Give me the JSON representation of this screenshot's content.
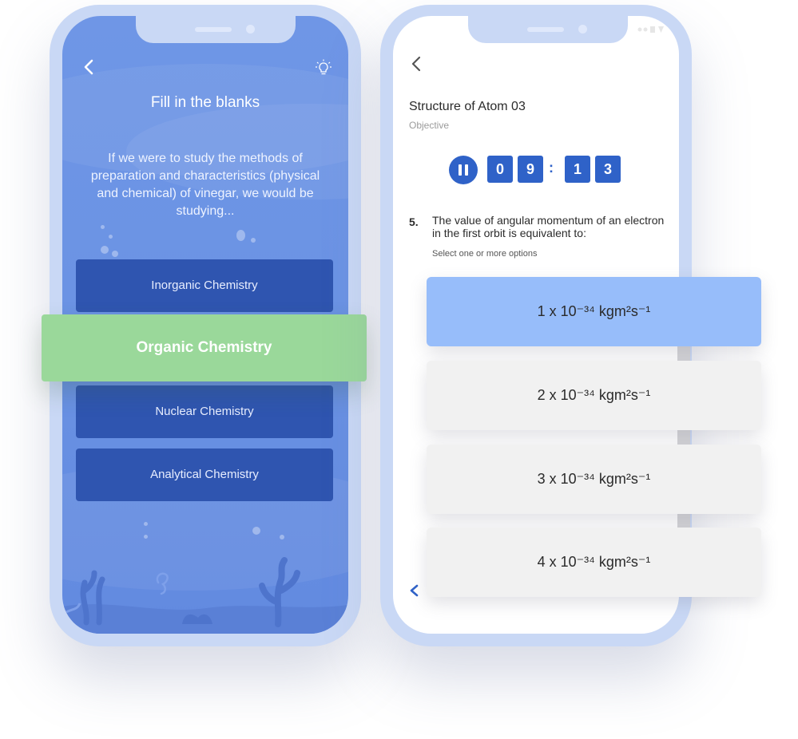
{
  "quiz_fill": {
    "title": "Fill in the blanks",
    "question": "If we were to study the methods of preparation and characteristics (physical and chemical) of vinegar, we would be studying...",
    "options": [
      {
        "label": "Inorganic Chemistry",
        "selected": false
      },
      {
        "label": "Organic Chemistry",
        "selected": true
      },
      {
        "label": "Nuclear Chemistry",
        "selected": false
      },
      {
        "label": "Analytical Chemistry",
        "selected": false
      }
    ],
    "colors": {
      "background": "#6f96e6",
      "option": "#2f55b0",
      "selected": "#9ad89a"
    }
  },
  "quiz_objective": {
    "title": "Structure of Atom 03",
    "subtitle": "Objective",
    "timer": {
      "min_tens": "0",
      "min_ones": "9",
      "separator": ":",
      "sec_tens": "1",
      "sec_ones": "3"
    },
    "question_number": "5.",
    "question": "The value of angular momentum of an electron in the first orbit is equivalent to:",
    "hint": "Select one or more options",
    "answers": [
      {
        "label": "1 x 10⁻³⁴ kgm²s⁻¹",
        "selected": true
      },
      {
        "label": "2 x 10⁻³⁴ kgm²s⁻¹",
        "selected": false
      },
      {
        "label": "3 x 10⁻³⁴ kgm²s⁻¹",
        "selected": false
      },
      {
        "label": "4 x 10⁻³⁴ kgm²s⁻¹",
        "selected": false
      }
    ],
    "colors": {
      "accent": "#2f62c8",
      "answer_selected": "#97bdfa",
      "answer_default": "#f1f1f1"
    }
  },
  "icons": [
    "back-arrow-icon",
    "lightbulb-icon",
    "pause-icon",
    "previous-arrow-icon"
  ]
}
